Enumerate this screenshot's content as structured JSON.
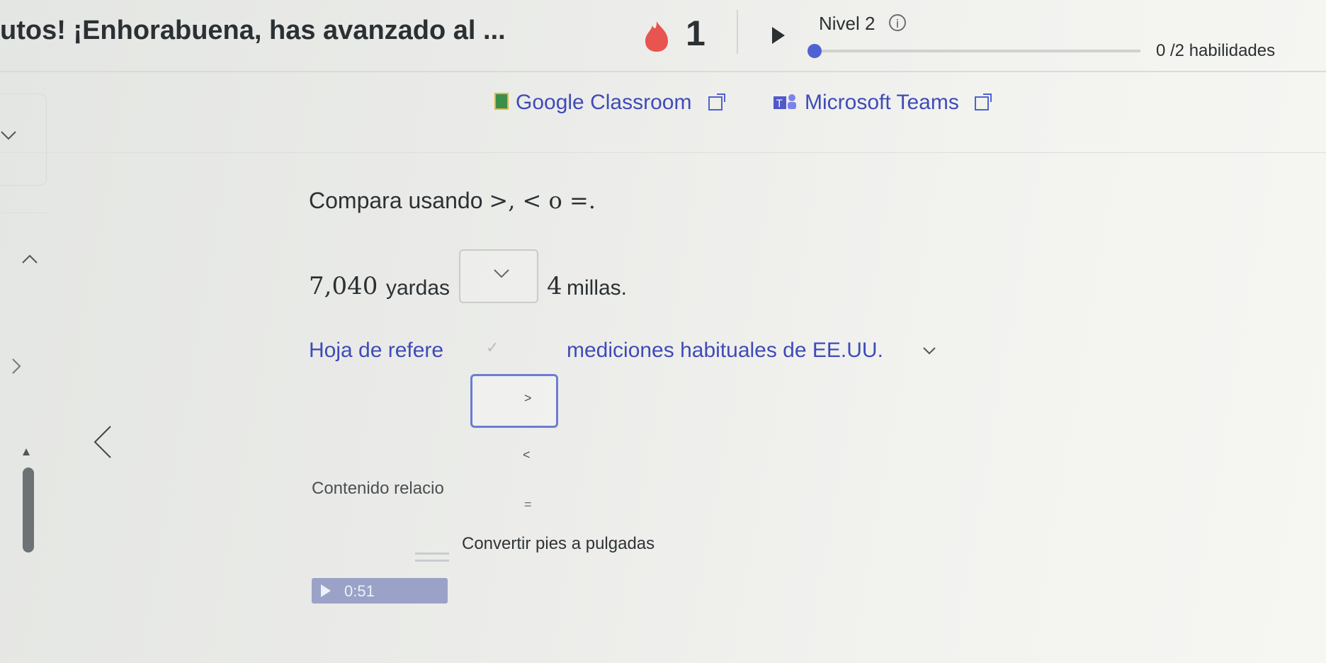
{
  "header": {
    "title": "utos! ¡Enhorabuena, has avanzado al ...",
    "streak_count": "1",
    "level_label": "Nivel 2",
    "info_glyph": "i",
    "skills_label": "0 /2 habilidades",
    "skills_progress": 0
  },
  "share": {
    "google_classroom": "Google Classroom",
    "microsoft_teams": "Microsoft Teams"
  },
  "question": {
    "prompt_text": "Compara usando",
    "prompt_math": ">, < o =.",
    "left_value": "7,040",
    "left_unit": "yardas",
    "right_value": "4",
    "right_unit": "millas."
  },
  "reference": {
    "part1": "Hoja de refere",
    "part2": "mediciones habituales de EE.UU."
  },
  "dropdown": {
    "options": [
      ">",
      "<",
      "="
    ]
  },
  "related": {
    "heading": "Contenido relacio",
    "item_title": "Convertir pies a pulgadas",
    "video_time": "0:51"
  },
  "colors": {
    "accent": "#3f4bb8",
    "progress": "#4f62d2",
    "streak": "#e8544f"
  },
  "icons": [
    "flame-icon",
    "play-icon",
    "info-icon",
    "google-classroom-icon",
    "microsoft-teams-icon",
    "external-link-icon",
    "chevron-down-icon",
    "chevron-up-icon",
    "chevron-right-icon",
    "chevron-left-icon"
  ]
}
